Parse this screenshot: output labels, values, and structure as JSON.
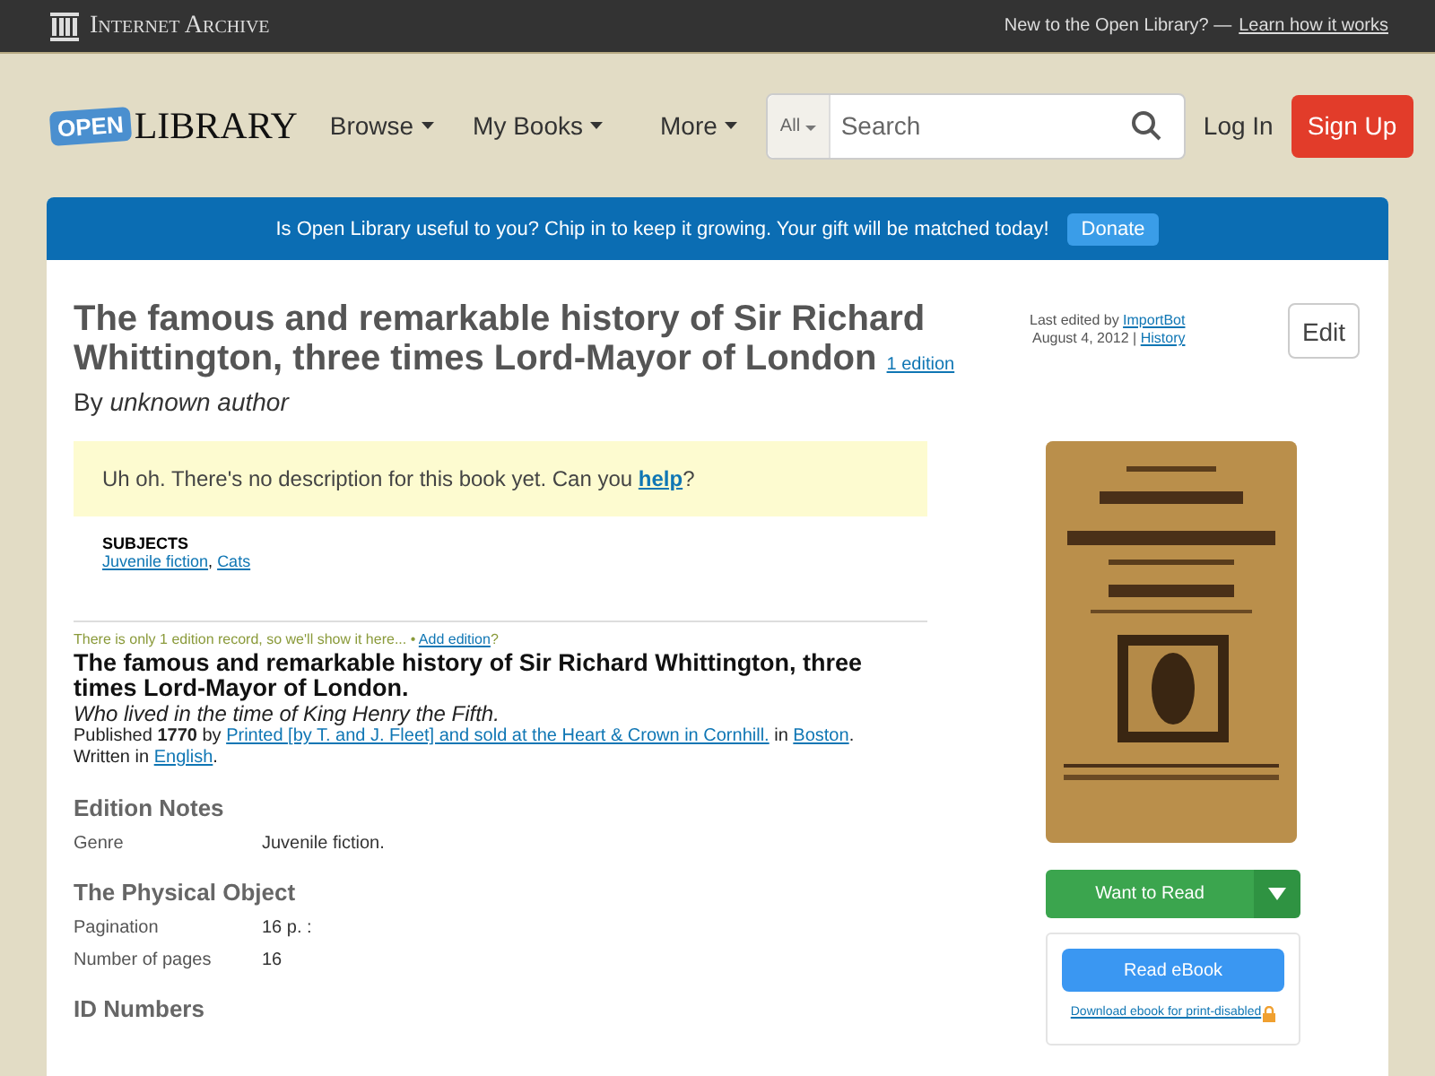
{
  "topbar": {
    "brand": "Internet Archive",
    "prompt": "New to the Open Library? —",
    "prompt_link": "Learn how it works"
  },
  "header": {
    "logo_open": "OPEN",
    "logo_library": "LIBRARY",
    "nav": [
      "Browse",
      "My Books",
      "More"
    ],
    "search_scope": "All",
    "search_placeholder": "Search",
    "login": "Log In",
    "signup": "Sign Up"
  },
  "banner": {
    "text": "Is Open Library useful to you? Chip in to keep it growing. Your gift will be matched today!",
    "button": "Donate"
  },
  "work": {
    "title": "The famous and remarkable history of Sir Richard Whittington, three times Lord-Mayor of London",
    "editions_link": "1 edition",
    "by": "By",
    "author": "unknown author",
    "edit_info": {
      "label": "Last edited by",
      "user": "ImportBot",
      "date": "August 4, 2012 |",
      "history": "History"
    },
    "edit_button": "Edit",
    "description_missing": "Uh oh. There's no description for this book yet. Can you",
    "help_link": "help",
    "help_after": "?",
    "subjects_heading": "SUBJECTS",
    "subjects": [
      "Juvenile fiction",
      "Cats"
    ],
    "subjects_separator": ","
  },
  "edition": {
    "notice": "There is only 1 edition record, so we'll show it here...  •",
    "add_link": "Add edition",
    "add_after": "?",
    "title": "The famous and remarkable history of Sir Richard Whittington, three times Lord-Mayor of London.",
    "subtitle": "Who lived in the time of King Henry the Fifth.",
    "published_label": "Published",
    "year": "1770",
    "by": "by",
    "publisher": "Printed [by T. and J. Fleet] and sold at the Heart & Crown in Cornhill.",
    "in": "in",
    "place": "Boston",
    "place_after": ".",
    "written_in": "Written in",
    "language": "English",
    "language_after": "."
  },
  "sections": [
    {
      "heading": "Edition Notes",
      "rows": [
        {
          "label": "Genre",
          "value": "Juvenile fiction."
        }
      ]
    },
    {
      "heading": "The Physical Object",
      "rows": [
        {
          "label": "Pagination",
          "value": "16 p. :"
        },
        {
          "label": "Number of pages",
          "value": "16"
        }
      ]
    },
    {
      "heading": "ID Numbers"
    }
  ],
  "sidebar": {
    "want_to_read": "Want to Read",
    "read_ebook": "Read eBook",
    "download_link": "Download ebook for print-disabled"
  }
}
